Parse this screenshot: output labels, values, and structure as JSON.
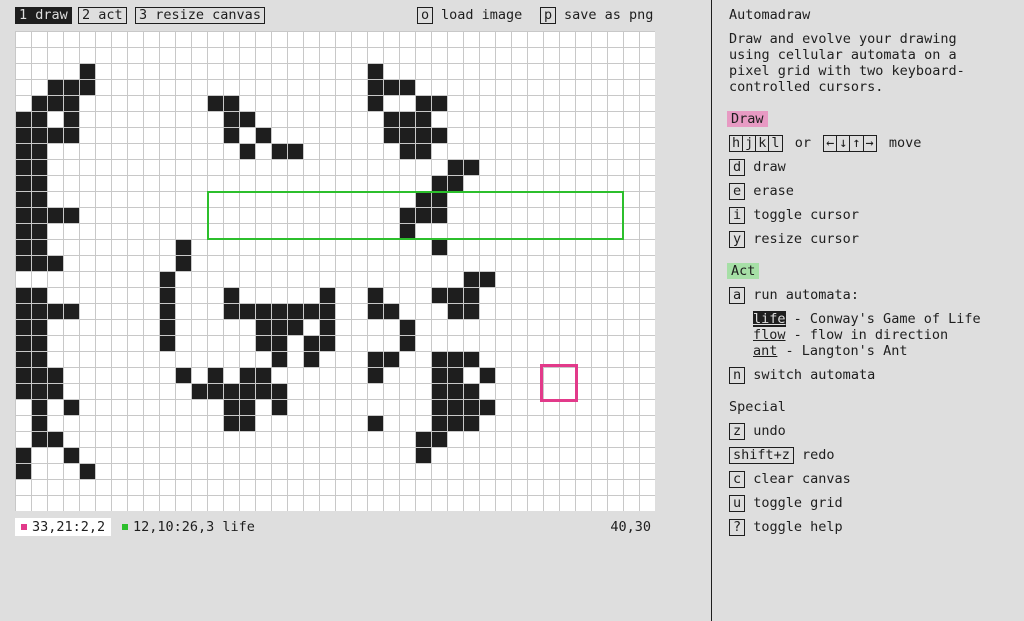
{
  "topbar": {
    "tabs": [
      {
        "key": "1",
        "label": "draw",
        "active": true
      },
      {
        "key": "2",
        "label": "act",
        "active": false
      },
      {
        "key": "3",
        "label": "resize canvas",
        "active": false
      }
    ],
    "actions": [
      {
        "key": "o",
        "label": "load image"
      },
      {
        "key": "p",
        "label": "save as png"
      }
    ]
  },
  "canvas": {
    "cols": 40,
    "rows": 30,
    "cells": [
      "0000000000000000000000000000000000000000",
      "0000000000000000000000000000000000000000",
      "0000100000000000000000100000000000000000",
      "0011100000000000000000111000000000000000",
      "0111000000001100000000100110000000000000",
      "1101000000000110000000011100000000000000",
      "1111000000000101000000011110000000000000",
      "1100000000000010110000001100000000000000",
      "1100000000000000000000000001100000000000",
      "1100000000000000000000000011000000000000",
      "1100000000000000000000000110000000000000",
      "1111000000000000000000001110000000000000",
      "1100000000000000000000001000000000000000",
      "1100000000100000000000000010000000000000",
      "1110000000100000000000000000000000000000",
      "0000000001000000000000000000110000000000",
      "1100000001000100000100100011100000000000",
      "1111000001000111111100110001100000000000",
      "1100000001000001110100001000000000000000",
      "1100000001000001101100001000000000000000",
      "1100000000000000101000110011100000000000",
      "1110000000101011000000100011010000000000",
      "1110000000011111100000000011100000000000",
      "0101000000000110100000000011110000000000",
      "0100000000000110000000100011100000000000",
      "0110000000000000000000000110000000000000",
      "1001000000000000000000000100000000000000",
      "1000100000000000000000000000000000000000",
      "0000000000000000000000000000000000000000",
      "0000000000000000000000000000000000000000"
    ],
    "grid_color": "#c8c8c8",
    "cell_color": "#1e1e1e"
  },
  "status": {
    "pink_cursor": "33,21:2,2",
    "green_cursor": "12,10:26,3 life",
    "canvas_size": "40,30",
    "pink_color": "#e23a8a",
    "green_color": "#2cbf2c"
  },
  "help": {
    "title": "Automadraw",
    "intro_lines": [
      "Draw and evolve your drawing",
      "using cellular automata on a",
      "pixel grid with two keyboard-",
      "controlled cursors."
    ],
    "draw_heading": "Draw",
    "draw_heading_color": "#e79ac3",
    "move_keys": [
      "h",
      "j",
      "k",
      "l"
    ],
    "move_or": "or",
    "arrow_keys": [
      "←",
      "↓",
      "↑",
      "→"
    ],
    "move_label": "move",
    "draw_items": [
      {
        "key": "d",
        "label": "draw"
      },
      {
        "key": "e",
        "label": "erase"
      },
      {
        "key": "i",
        "label": "toggle cursor"
      },
      {
        "key": "y",
        "label": "resize cursor"
      }
    ],
    "act_heading": "Act",
    "act_heading_color": "#a6dfa6",
    "run_key": "a",
    "run_label": "run automata:",
    "automata": [
      {
        "name": "life",
        "desc": "- Conway's Game of Life",
        "selected": true
      },
      {
        "name": "flow",
        "desc": "- flow in direction",
        "selected": false
      },
      {
        "name": "ant",
        "desc": "- Langton's Ant",
        "selected": false
      }
    ],
    "switch_key": "n",
    "switch_label": "switch automata",
    "special_heading": "Special",
    "special_items": [
      {
        "key": "z",
        "label": "undo"
      },
      {
        "key": "shift+z",
        "label": "redo"
      },
      {
        "key": "c",
        "label": "clear canvas"
      },
      {
        "key": "u",
        "label": "toggle grid"
      },
      {
        "key": "?",
        "label": "toggle help"
      }
    ]
  }
}
